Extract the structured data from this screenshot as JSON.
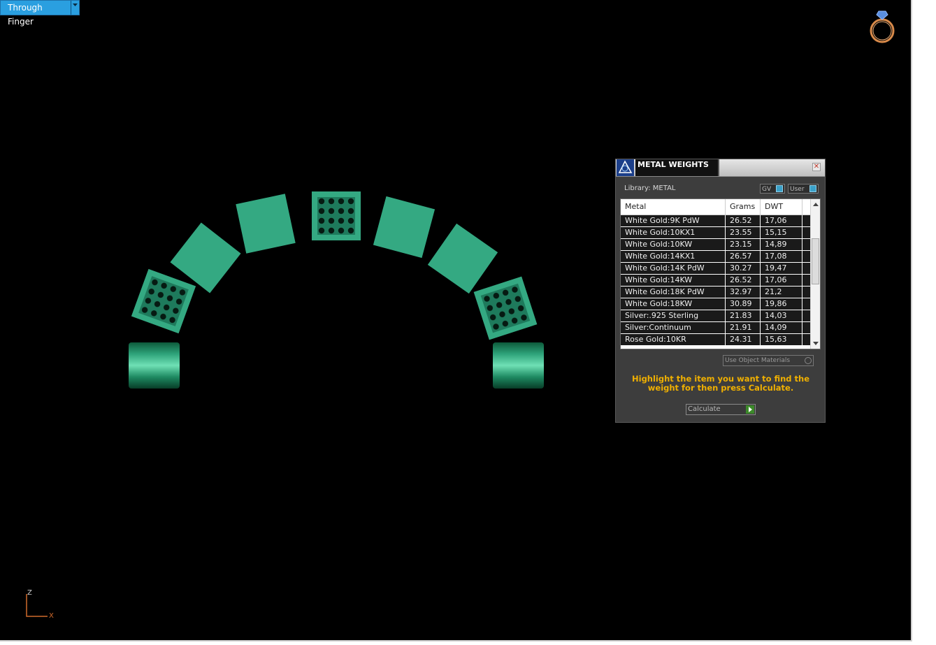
{
  "viewport": {
    "view_mode": "Through Finger",
    "background_color": "#000000",
    "object_color": "#34a982"
  },
  "axis": {
    "z_label": "Z",
    "x_label": "X",
    "color": "#d06a2c"
  },
  "panel": {
    "title": "METAL WEIGHTS",
    "library_label": "Library: METAL",
    "toggle_gv": "GV",
    "toggle_user": "User",
    "columns": [
      "Metal",
      "Grams",
      "DWT"
    ],
    "rows": [
      [
        "White Gold:9K PdW",
        "26.52",
        "17,06"
      ],
      [
        "White Gold:10KX1",
        "23.55",
        "15,15"
      ],
      [
        "White Gold:10KW",
        "23.15",
        "14,89"
      ],
      [
        "White Gold:14KX1",
        "26.57",
        "17,08"
      ],
      [
        "White Gold:14K PdW",
        "30.27",
        "19,47"
      ],
      [
        "White Gold:14KW",
        "26.52",
        "17,06"
      ],
      [
        "White Gold:18K PdW",
        "32.97",
        "21,2"
      ],
      [
        "White Gold:18KW",
        "30.89",
        "19,86"
      ],
      [
        "Silver:.925 Sterling",
        "21.83",
        "14,03"
      ],
      [
        "Silver:Continuum",
        "21.91",
        "14,09"
      ],
      [
        "Rose Gold:10KR",
        "24.31",
        "15,63"
      ]
    ],
    "use_object_materials": "Use Object Materials",
    "hint": "Highlight the item you want to find the weight for then press Calculate.",
    "calculate_label": "Calculate",
    "hint_color": "#f0b000"
  },
  "icons": {
    "dropdown": "chevron-down-icon",
    "ring": "ring-icon",
    "close": "close-icon",
    "logo": "app-logo-icon"
  }
}
